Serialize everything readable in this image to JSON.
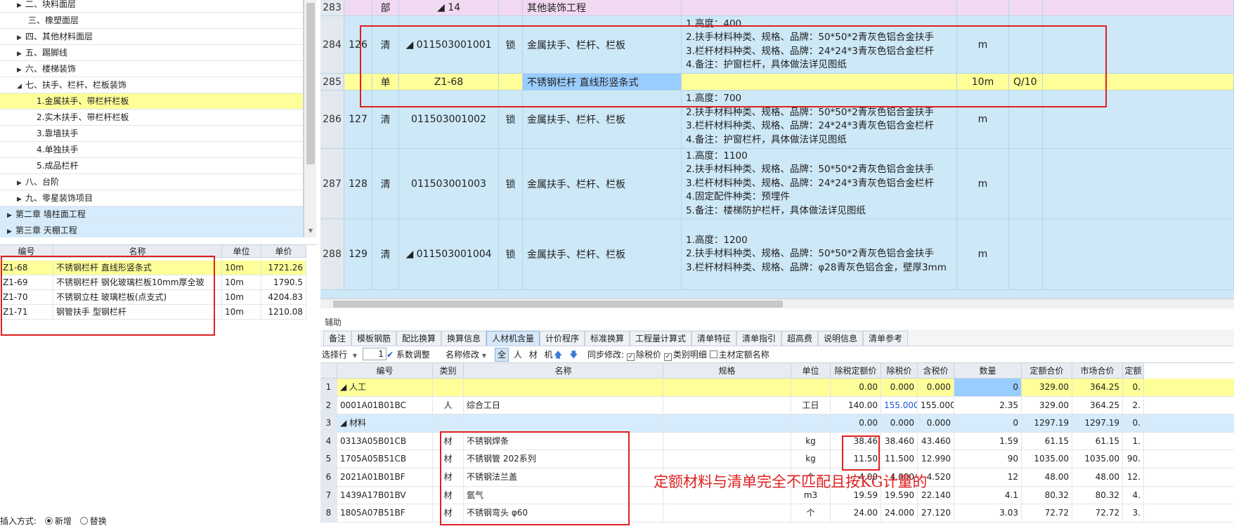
{
  "tree": {
    "items": [
      {
        "label": "二、块料面层",
        "arrow": "▶",
        "indent": 36
      },
      {
        "label": "三、橡塑面层",
        "arrow": "",
        "indent": 40
      },
      {
        "label": "四、其他材料面层",
        "arrow": "▶",
        "indent": 36
      },
      {
        "label": "五、踢脚线",
        "arrow": "▶",
        "indent": 36
      },
      {
        "label": "六、楼梯装饰",
        "arrow": "▶",
        "indent": 36
      },
      {
        "label": "七、扶手、栏杆、栏板装饰",
        "arrow": "◢",
        "indent": 36
      },
      {
        "label": "1.金属扶手、带栏杆栏板",
        "arrow": "",
        "indent": 52
      },
      {
        "label": "2.实木扶手、带栏杆栏板",
        "arrow": "",
        "indent": 52
      },
      {
        "label": "3.靠墙扶手",
        "arrow": "",
        "indent": 52
      },
      {
        "label": "4.单独扶手",
        "arrow": "",
        "indent": 52
      },
      {
        "label": "5.成品栏杆",
        "arrow": "",
        "indent": 52
      },
      {
        "label": "八、台阶",
        "arrow": "▶",
        "indent": 36
      },
      {
        "label": "九、零星装饰项目",
        "arrow": "▶",
        "indent": 36
      },
      {
        "label": "第二章 墙柱面工程",
        "arrow": "▶",
        "indent": 22
      },
      {
        "label": "第三章 天棚工程",
        "arrow": "▶",
        "indent": 22
      }
    ],
    "selected_index": 6
  },
  "quota_table": {
    "headers": [
      "编号",
      "名称",
      "单位",
      "单价"
    ],
    "rows": [
      {
        "code": "Z1-68",
        "name": "不锈钢栏杆 直线形竖条式",
        "unit": "10m",
        "price": "1721.26"
      },
      {
        "code": "Z1-69",
        "name": "不锈钢栏杆 钢化玻璃栏板10mm厚全玻",
        "unit": "10m",
        "price": "1790.5"
      },
      {
        "code": "Z1-70",
        "name": "不锈钢立柱 玻璃栏板(点支式)",
        "unit": "10m",
        "price": "4204.83"
      },
      {
        "code": "Z1-71",
        "name": "钢管扶手 型钢栏杆",
        "unit": "10m",
        "price": "1210.08"
      }
    ]
  },
  "insert_mode": {
    "label": "插入方式:",
    "opt_new": "新增",
    "opt_replace": "替换"
  },
  "bill": {
    "rows": [
      {
        "no": "283",
        "seq": "",
        "type": "部",
        "code": "◢ 14",
        "lock": "",
        "name": "其他装饰工程",
        "features": [],
        "unit": "",
        "qty": "",
        "style": "pink"
      },
      {
        "no": "284",
        "seq": "126",
        "type": "清",
        "code": "◢ 011503001001",
        "lock": "锁",
        "name": "金属扶手、栏杆、栏板",
        "features": [
          "1.高度：400",
          "2.扶手材料种类、规格、品牌：50*50*2青灰色铝合金扶手",
          "3.栏杆材料种类、规格、品牌：24*24*3青灰色铝合金栏杆",
          "4.备注：护窗栏杆，具体做法详见图纸"
        ],
        "unit": "m",
        "qty": "",
        "style": "blue"
      },
      {
        "no": "285",
        "seq": "",
        "type": "单",
        "code": "Z1-68",
        "lock": "",
        "name": "不锈钢栏杆 直线形竖条式",
        "features": [],
        "unit": "10m",
        "qty": "Q/10",
        "style": "yel"
      },
      {
        "no": "286",
        "seq": "127",
        "type": "清",
        "code": "011503001002",
        "lock": "锁",
        "name": "金属扶手、栏杆、栏板",
        "features": [
          "1.高度：700",
          "2.扶手材料种类、规格、品牌：50*50*2青灰色铝合金扶手",
          "3.栏杆材料种类、规格、品牌：24*24*3青灰色铝合金栏杆",
          "4.备注：护窗栏杆，具体做法详见图纸"
        ],
        "unit": "m",
        "qty": "",
        "style": "blue"
      },
      {
        "no": "287",
        "seq": "128",
        "type": "清",
        "code": "011503001003",
        "lock": "锁",
        "name": "金属扶手、栏杆、栏板",
        "features": [
          "1.高度：1100",
          "2.扶手材料种类、规格、品牌：50*50*2青灰色铝合金扶手",
          "3.栏杆材料种类、规格、品牌：24*24*3青灰色铝合金栏杆",
          "4.固定配件种类：预埋件",
          "5.备注：楼梯防护栏杆，具体做法详见图纸"
        ],
        "unit": "m",
        "qty": "",
        "style": "blue"
      },
      {
        "no": "288",
        "seq": "129",
        "type": "清",
        "code": "◢ 011503001004",
        "lock": "锁",
        "name": "金属扶手、栏杆、栏板",
        "features": [
          "1.高度：1200",
          "2.扶手材料种类、规格、品牌：50*50*2青灰色铝合金扶手",
          "3.栏杆材料种类、规格、品牌：φ28青灰色铝合金，壁厚3mm"
        ],
        "unit": "m",
        "qty": "",
        "style": "blue"
      }
    ]
  },
  "aux": {
    "title": "辅助",
    "tabs": [
      "备注",
      "模板钢筋",
      "配比换算",
      "换算信息",
      "人材机含量",
      "计价程序",
      "标准换算",
      "工程量计算式",
      "清单特征",
      "清单指引",
      "超高费",
      "说明信息",
      "清单参考"
    ],
    "active_tab": 4
  },
  "toolbar": {
    "select_row": "选择行",
    "row_value": "1",
    "coef_adjust": "系数调整",
    "name_modify": "名称修改",
    "filter_all": "全",
    "filter_ren": "人",
    "filter_cai": "材",
    "filter_ji": "机",
    "sync_modify": "同步修改:",
    "chk_tax_price": "除税价",
    "chk_category": "类别明细",
    "chk_main_mat": "主材定额名称"
  },
  "res_table": {
    "headers": [
      "编号",
      "类别",
      "名称",
      "规格",
      "单位",
      "除税定额价",
      "除税价",
      "含税价",
      "数量",
      "定额合价",
      "市场合价",
      "定额"
    ],
    "rows": [
      {
        "no": "1",
        "code": "◢ 人工",
        "cat": "",
        "name": "",
        "spec": "",
        "unit": "",
        "quota_price": "0.00",
        "tax_ex": "0.000",
        "tax_in": "0.000",
        "qty": "0",
        "quota_total": "329.00",
        "market_total": "364.25",
        "extra": "0.",
        "style": "yel"
      },
      {
        "no": "2",
        "code": "0001A01B01BC",
        "cat": "人",
        "name": "综合工日",
        "spec": "",
        "unit": "工日",
        "quota_price": "140.00",
        "tax_ex": "155.000",
        "tax_in": "155.000",
        "qty": "2.35",
        "quota_total": "329.00",
        "market_total": "364.25",
        "extra": "2.",
        "style": ""
      },
      {
        "no": "3",
        "code": "◢ 材料",
        "cat": "",
        "name": "",
        "spec": "",
        "unit": "",
        "quota_price": "0.00",
        "tax_ex": "0.000",
        "tax_in": "0.000",
        "qty": "0",
        "quota_total": "1297.19",
        "market_total": "1297.19",
        "extra": "0.",
        "style": "blue"
      },
      {
        "no": "4",
        "code": "0313A05B01CB",
        "cat": "材",
        "name": "不锈钢焊条",
        "spec": "",
        "unit": "kg",
        "quota_price": "38.46",
        "tax_ex": "38.460",
        "tax_in": "43.460",
        "qty": "1.59",
        "quota_total": "61.15",
        "market_total": "61.15",
        "extra": "1.",
        "style": ""
      },
      {
        "no": "5",
        "code": "1705A05B51CB",
        "cat": "材",
        "name": "不锈钢管 202系列",
        "spec": "",
        "unit": "kg",
        "quota_price": "11.50",
        "tax_ex": "11.500",
        "tax_in": "12.990",
        "qty": "90",
        "quota_total": "1035.00",
        "market_total": "1035.00",
        "extra": "90.",
        "style": ""
      },
      {
        "no": "6",
        "code": "2021A01B01BF",
        "cat": "材",
        "name": "不锈钢法兰盖",
        "spec": "",
        "unit": "个",
        "quota_price": "4.00",
        "tax_ex": "4.000",
        "tax_in": "4.520",
        "qty": "12",
        "quota_total": "48.00",
        "market_total": "48.00",
        "extra": "12.",
        "style": ""
      },
      {
        "no": "7",
        "code": "1439A17B01BV",
        "cat": "材",
        "name": "氩气",
        "spec": "",
        "unit": "m3",
        "quota_price": "19.59",
        "tax_ex": "19.590",
        "tax_in": "22.140",
        "qty": "4.1",
        "quota_total": "80.32",
        "market_total": "80.32",
        "extra": "4.",
        "style": ""
      },
      {
        "no": "8",
        "code": "1805A07B51BF",
        "cat": "材",
        "name": "不锈钢弯头 φ60",
        "spec": "",
        "unit": "个",
        "quota_price": "24.00",
        "tax_ex": "24.000",
        "tax_in": "27.120",
        "qty": "3.03",
        "quota_total": "72.72",
        "market_total": "72.72",
        "extra": "3.",
        "style": ""
      }
    ]
  },
  "annotation": {
    "note": "定额材料与清单完全不匹配且按KG计量的",
    "color": "#e02020"
  },
  "colors": {
    "selected_yellow": "#ffff99",
    "bill_blue": "#cde8f7",
    "section_pink": "#f2d9f2",
    "highlight_blue": "#99ccff",
    "link_blue": "#1a56d6"
  }
}
